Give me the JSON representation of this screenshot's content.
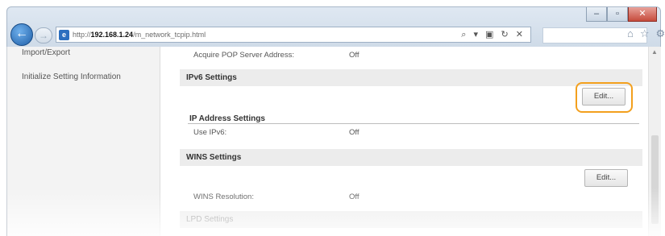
{
  "browser": {
    "window_buttons": [
      "‒",
      "▫",
      "✕"
    ],
    "url_prefix": "http://",
    "url_host": "192.168.1.24",
    "url_path": "/m_network_tcpip.html",
    "address_tools": "⌕ ▾ ▣ ↻ ✕",
    "toolbar_icons": [
      "⌂",
      "☆",
      "⚙"
    ]
  },
  "sidebar": {
    "items": [
      {
        "label": "Import/Export"
      },
      {
        "label": "Initialize Setting Information"
      }
    ]
  },
  "main": {
    "pop_row": {
      "label": "Acquire POP Server Address:",
      "value": "Off"
    },
    "ipv6": {
      "title": "IPv6 Settings",
      "edit_label": "Edit...",
      "subhead": "IP Address Settings",
      "use_row": {
        "label": "Use IPv6:",
        "value": "Off"
      }
    },
    "wins": {
      "title": "WINS Settings",
      "edit_label": "Edit...",
      "resolution_row": {
        "label": "WINS Resolution:",
        "value": "Off"
      }
    },
    "lpd": {
      "title": "LPD Settings"
    }
  },
  "colors": {
    "highlight": "#f3a01e",
    "section_bg": "#ececec"
  }
}
